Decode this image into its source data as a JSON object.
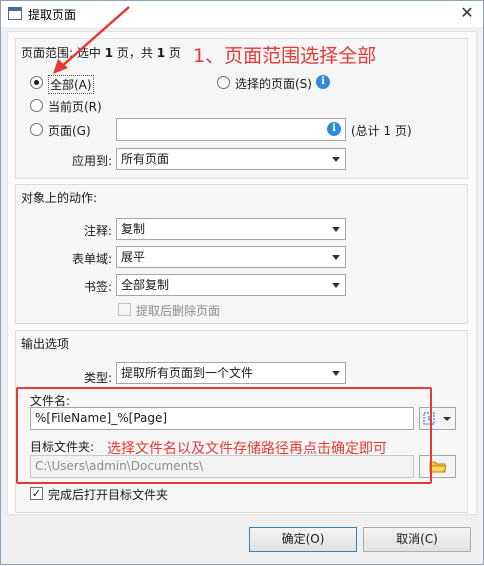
{
  "window": {
    "title": "提取页面",
    "close_glyph": "✕"
  },
  "page_range": {
    "group_title_prefix": "页面范围: 选中",
    "group_title_selected": "1",
    "group_title_mid": "页，共",
    "group_title_total": "1",
    "group_title_suffix": "页",
    "options": {
      "all": "全部(A)",
      "current": "当前页(R)",
      "pages": "页面(G)",
      "selected": "选择的页面(S)"
    },
    "pages_input_value": "",
    "total_pages_text": "(总计 1 页)",
    "apply_to_label": "应用到:",
    "apply_to_value": "所有页面"
  },
  "actions_on_objects": {
    "group_title": "对象上的动作:",
    "comment_label": "注释:",
    "comment_value": "复制",
    "form_field_label": "表单域:",
    "form_field_value": "展平",
    "bookmark_label": "书签:",
    "bookmark_value": "全部复制",
    "delete_after_extract": "提取后删除页面"
  },
  "output": {
    "group_title": "输出选项",
    "type_label": "类型:",
    "type_value": "提取所有页面到一个文件",
    "filename_label": "文件名:",
    "filename_value": "%[FileName]_%[Page]",
    "target_folder_label": "目标文件夹:",
    "target_folder_value": "C:\\Users\\admin\\Documents\\",
    "open_folder_after": "完成后打开目标文件夹"
  },
  "buttons": {
    "ok": "确定(O)",
    "cancel": "取消(C)"
  },
  "annotations": {
    "step1": "1、页面范围选择全部",
    "step2": "选择文件名以及文件存储路径再点击确定即可"
  },
  "colors": {
    "annotation_red": "#e53935",
    "info_blue": "#2f8ad8",
    "default_button_border": "#3c7fb1"
  }
}
